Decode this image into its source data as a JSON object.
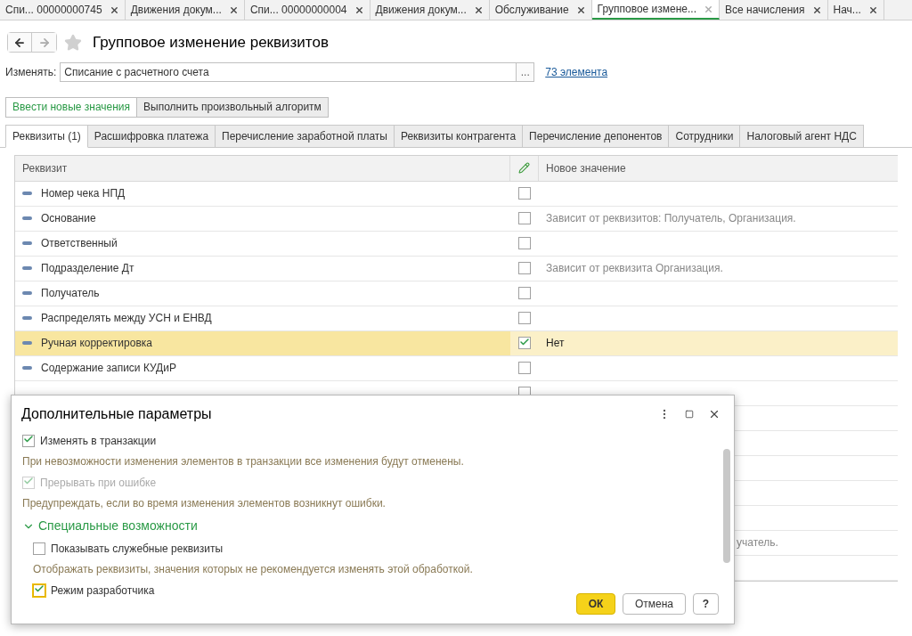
{
  "window_tabs": [
    {
      "label": "Спи... 00000000745",
      "selected": false
    },
    {
      "label": "Движения докум...",
      "selected": false
    },
    {
      "label": "Спи... 00000000004",
      "selected": false
    },
    {
      "label": "Движения докум...",
      "selected": false
    },
    {
      "label": "Обслуживание",
      "selected": false
    },
    {
      "label": "Групповое измене...",
      "selected": true
    },
    {
      "label": "Все начисления",
      "selected": false
    },
    {
      "label": "Нач...",
      "selected": false
    }
  ],
  "title": "Групповое изменение реквизитов",
  "change_field": {
    "label": "Изменять:",
    "value": "Списание с расчетного счета",
    "select_button": "...",
    "link": "73 элемента"
  },
  "mode_buttons": [
    {
      "label": "Ввести новые значения",
      "selected": true
    },
    {
      "label": "Выполнить произвольный алгоритм",
      "selected": false
    }
  ],
  "tabs": [
    {
      "label": "Реквизиты (1)",
      "selected": true
    },
    {
      "label": "Расшифровка платежа",
      "selected": false
    },
    {
      "label": "Перечисление заработной платы",
      "selected": false
    },
    {
      "label": "Реквизиты контрагента",
      "selected": false
    },
    {
      "label": "Перечисление депонентов",
      "selected": false
    },
    {
      "label": "Сотрудники",
      "selected": false
    },
    {
      "label": "Налоговый агент НДС",
      "selected": false
    }
  ],
  "table": {
    "columns": [
      "Реквизит",
      "Новое значение"
    ],
    "rows": [
      {
        "name": "Номер чека НПД",
        "checked": false,
        "value": "",
        "selected": false
      },
      {
        "name": "Основание",
        "checked": false,
        "value": "Зависит от реквизитов: Получатель, Организация.",
        "selected": false
      },
      {
        "name": "Ответственный",
        "checked": false,
        "value": "",
        "selected": false
      },
      {
        "name": "Подразделение Дт",
        "checked": false,
        "value": "Зависит от реквизита Организация.",
        "selected": false
      },
      {
        "name": "Получатель",
        "checked": false,
        "value": "",
        "selected": false
      },
      {
        "name": "Распределять между УСН и ЕНВД",
        "checked": false,
        "value": "",
        "selected": false
      },
      {
        "name": "Ручная корректировка",
        "checked": true,
        "value": "Нет",
        "selected": true
      },
      {
        "name": "Содержание записи КУДиР",
        "checked": false,
        "value": "",
        "selected": false
      },
      {
        "checked": false,
        "value": "",
        "selected": false
      }
    ],
    "hidden_row_fragment": "учатель."
  },
  "dialog": {
    "title": "Дополнительные параметры",
    "options": [
      {
        "kind": "checkbox",
        "label": "Изменять в транзакции",
        "checked": true,
        "disabled": false
      },
      {
        "kind": "hint",
        "text": "При невозможности изменения элементов в транзакции все изменения будут отменены."
      },
      {
        "kind": "checkbox",
        "label": "Прерывать при ошибке",
        "checked": true,
        "disabled": true
      },
      {
        "kind": "hint",
        "text": "Предупреждать, если во время изменения элементов возникнут ошибки."
      },
      {
        "kind": "group",
        "label": "Специальные возможности",
        "expanded": true
      },
      {
        "kind": "checkbox",
        "label": "Показывать служебные реквизиты",
        "checked": false,
        "disabled": false
      },
      {
        "kind": "hint",
        "text": "Отображать реквизиты, значения которых не рекомендуется изменять этой обработкой."
      },
      {
        "kind": "checkbox",
        "label": "Режим разработчика",
        "checked": true,
        "disabled": false,
        "focused": true
      }
    ],
    "buttons": [
      "ОК",
      "Отмена",
      "?"
    ]
  }
}
